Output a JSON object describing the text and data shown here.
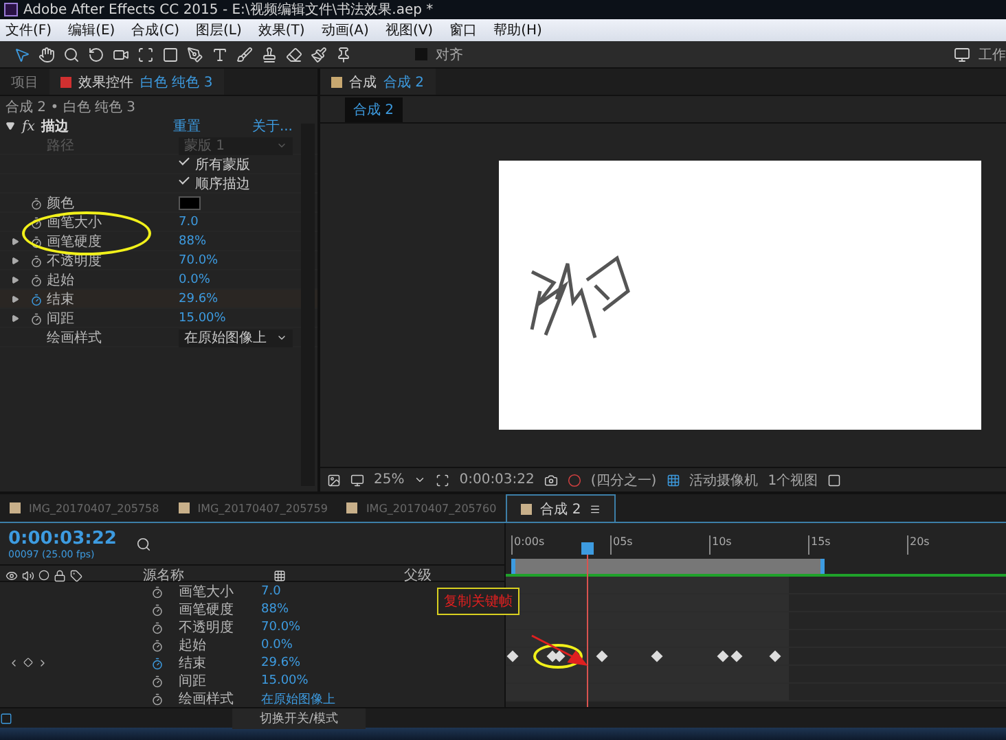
{
  "window": {
    "title": "Adobe After Effects CC 2015 - E:\\视频编辑文件\\书法效果.aep *"
  },
  "menu": [
    "文件(F)",
    "编辑(E)",
    "合成(C)",
    "图层(L)",
    "效果(T)",
    "动画(A)",
    "视图(V)",
    "窗口",
    "帮助(H)"
  ],
  "toolbar": {
    "snap": {
      "label": "对齐",
      "checked": false
    },
    "workspace": "工作"
  },
  "effect_controls": {
    "tabs": [
      {
        "label": "项目",
        "selected": false
      },
      {
        "label": "效果控件",
        "target": "白色 纯色 3",
        "selected": true
      }
    ],
    "breadcrumb": "合成 2 • 白色 纯色 3",
    "effect": {
      "badge": "fx",
      "name": "描边",
      "expanded": true,
      "reset": "重置",
      "about": "关于..."
    },
    "properties": [
      {
        "kind": "dropdown",
        "name": "路径",
        "value": "蒙版 1",
        "disabled": true
      },
      {
        "kind": "checkbox",
        "label": "所有蒙版",
        "checked": true
      },
      {
        "kind": "checkbox",
        "label": "顺序描边",
        "checked": true
      },
      {
        "kind": "color",
        "name": "颜色",
        "color": "#000000"
      },
      {
        "kind": "value",
        "name": "画笔大小",
        "value": "7.0",
        "expandable": false,
        "animated": false
      },
      {
        "kind": "value",
        "name": "画笔硬度",
        "value": "88%",
        "expandable": true,
        "animated": false
      },
      {
        "kind": "value",
        "name": "不透明度",
        "value": "70.0%",
        "expandable": true,
        "animated": false
      },
      {
        "kind": "value",
        "name": "起始",
        "value": "0.0%",
        "expandable": true,
        "animated": false
      },
      {
        "kind": "value",
        "name": "结束",
        "value": "29.6%",
        "expandable": true,
        "animated": true
      },
      {
        "kind": "value",
        "name": "间距",
        "value": "15.00%",
        "expandable": true,
        "animated": false
      },
      {
        "kind": "dropdown",
        "name": "绘画样式",
        "value": "在原始图像上",
        "disabled": false
      }
    ]
  },
  "composition": {
    "tab": {
      "label": "合成",
      "target": "合成 2"
    },
    "sub_tab": "合成 2",
    "viewer_toolbar": {
      "zoom": "25%",
      "timecode": "0:00:03:22",
      "resolution": "(四分之一)",
      "camera": "活动摄像机",
      "views": "1个视图"
    }
  },
  "timeline": {
    "tabs": [
      {
        "label": "IMG_20170407_205758",
        "selected": false,
        "color": "#c8b08a"
      },
      {
        "label": "IMG_20170407_205759",
        "selected": false,
        "color": "#c8b08a"
      },
      {
        "label": "IMG_20170407_205760",
        "selected": false,
        "color": "#c8b08a"
      },
      {
        "label": "合成 2",
        "selected": true,
        "color": "#c8b08a"
      }
    ],
    "timecode": "0:00:03:22",
    "frame_info": "00097 (25.00 fps)",
    "columns": {
      "source_name": "源名称",
      "parent": "父级"
    },
    "ruler": [
      "0:00s",
      "05s",
      "10s",
      "15s",
      "20s"
    ],
    "layers": [
      {
        "name": "画笔大小",
        "value": "7.0",
        "animated": false
      },
      {
        "name": "画笔硬度",
        "value": "88%",
        "animated": false
      },
      {
        "name": "不透明度",
        "value": "70.0%",
        "animated": false
      },
      {
        "name": "起始",
        "value": "0.0%",
        "animated": false
      },
      {
        "name": "结束",
        "value": "29.6%",
        "animated": true
      },
      {
        "name": "间距",
        "value": "15.00%",
        "animated": false
      },
      {
        "name": "绘画样式",
        "value": "在原始图像上",
        "animated": false
      }
    ],
    "toggle_label": "切换开关/模式"
  },
  "annotation": {
    "label": "复制关键帧"
  }
}
